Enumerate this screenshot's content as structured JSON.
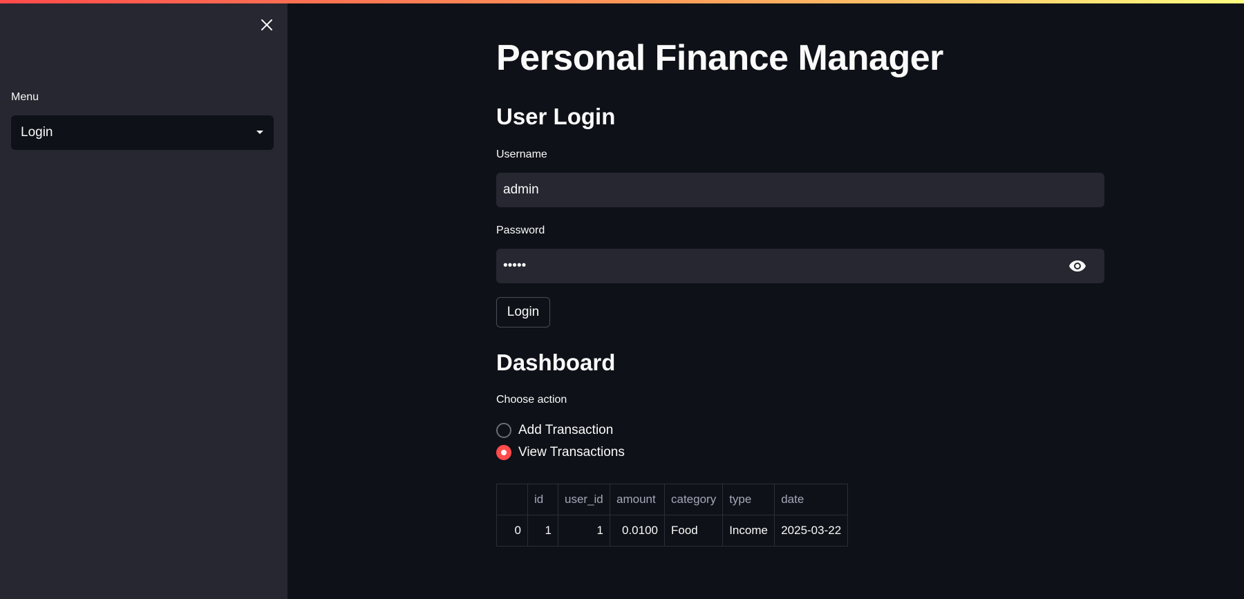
{
  "sidebar": {
    "close_icon": "close-icon",
    "menu_label": "Menu",
    "menu_select": {
      "value": "Login",
      "icon": "caret-down-icon"
    }
  },
  "main": {
    "title": "Personal Finance Manager",
    "login": {
      "heading": "User Login",
      "username_label": "Username",
      "username_value": "admin",
      "password_label": "Password",
      "password_masked": "•••••",
      "password_toggle_icon": "eye-icon",
      "login_button": "Login"
    },
    "dashboard": {
      "heading": "Dashboard",
      "choose_label": "Choose action",
      "options": [
        {
          "label": "Add Transaction",
          "selected": false
        },
        {
          "label": "View Transactions",
          "selected": true
        }
      ]
    },
    "table": {
      "columns": [
        "",
        "id",
        "user_id",
        "amount",
        "category",
        "type",
        "date"
      ],
      "rows": [
        [
          "0",
          "1",
          "1",
          "0.0100",
          "Food",
          "Income",
          "2025-03-22"
        ]
      ]
    }
  },
  "colors": {
    "background": "#0e1117",
    "sidebar": "#262730",
    "accent": "#ff4b4b",
    "input_bg": "#262730"
  }
}
